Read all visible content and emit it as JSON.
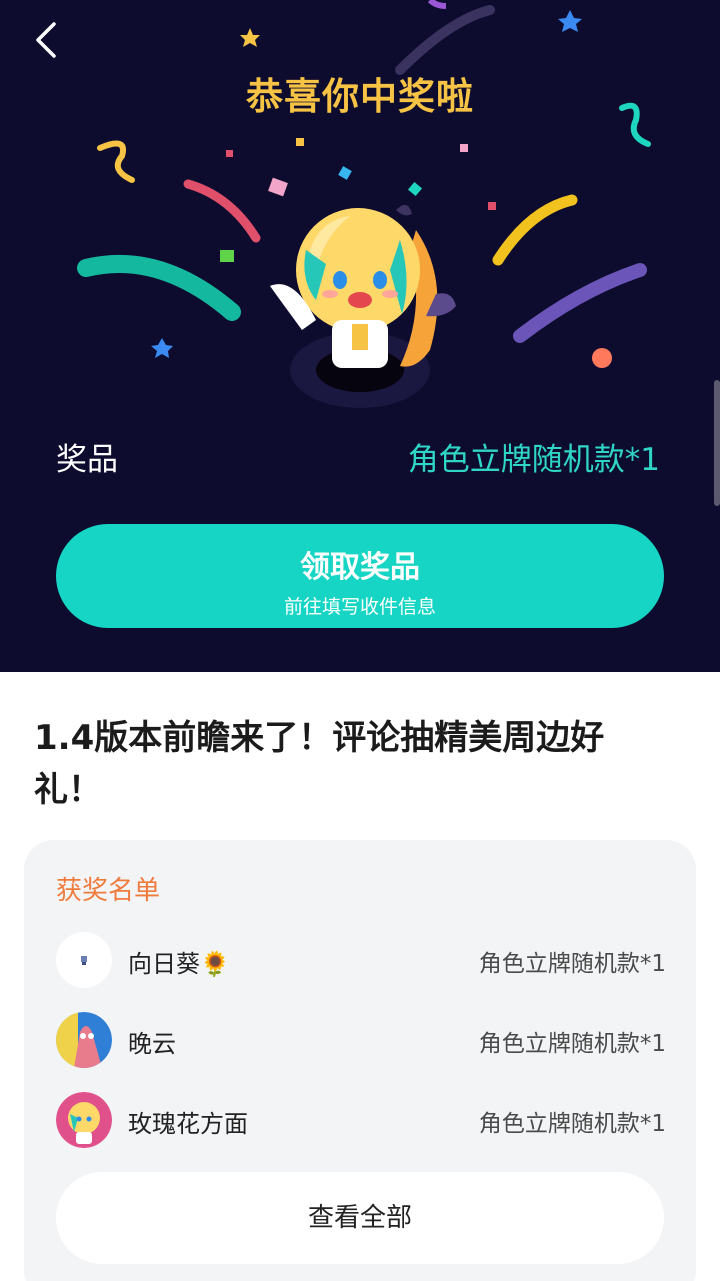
{
  "header": {
    "back_icon": "chevron-left-icon",
    "title": "恭喜你中奖啦"
  },
  "prize": {
    "label": "奖品",
    "value": "角色立牌随机款*1"
  },
  "claim_button": {
    "label": "领取奖品",
    "sublabel": "前往填写收件信息"
  },
  "article": {
    "title": "1.4版本前瞻来了！评论抽精美周边好礼！"
  },
  "winners": {
    "title": "获奖名单",
    "items": [
      {
        "name": "向日葵🌻",
        "prize": "角色立牌随机款*1",
        "avatar": "small-figure-avatar"
      },
      {
        "name": "晚云",
        "prize": "角色立牌随机款*1",
        "avatar": "starfish-avatar"
      },
      {
        "name": "玫瑰花方面",
        "prize": "角色立牌随机款*1",
        "avatar": "mascot-avatar"
      }
    ],
    "view_all_label": "查看全部"
  },
  "colors": {
    "hero_bg": "#0d0b2e",
    "title_gold": "#f6c344",
    "accent_teal": "#16d5c5",
    "prize_teal": "#2fd6c6",
    "winners_orange": "#ef7b3d"
  }
}
